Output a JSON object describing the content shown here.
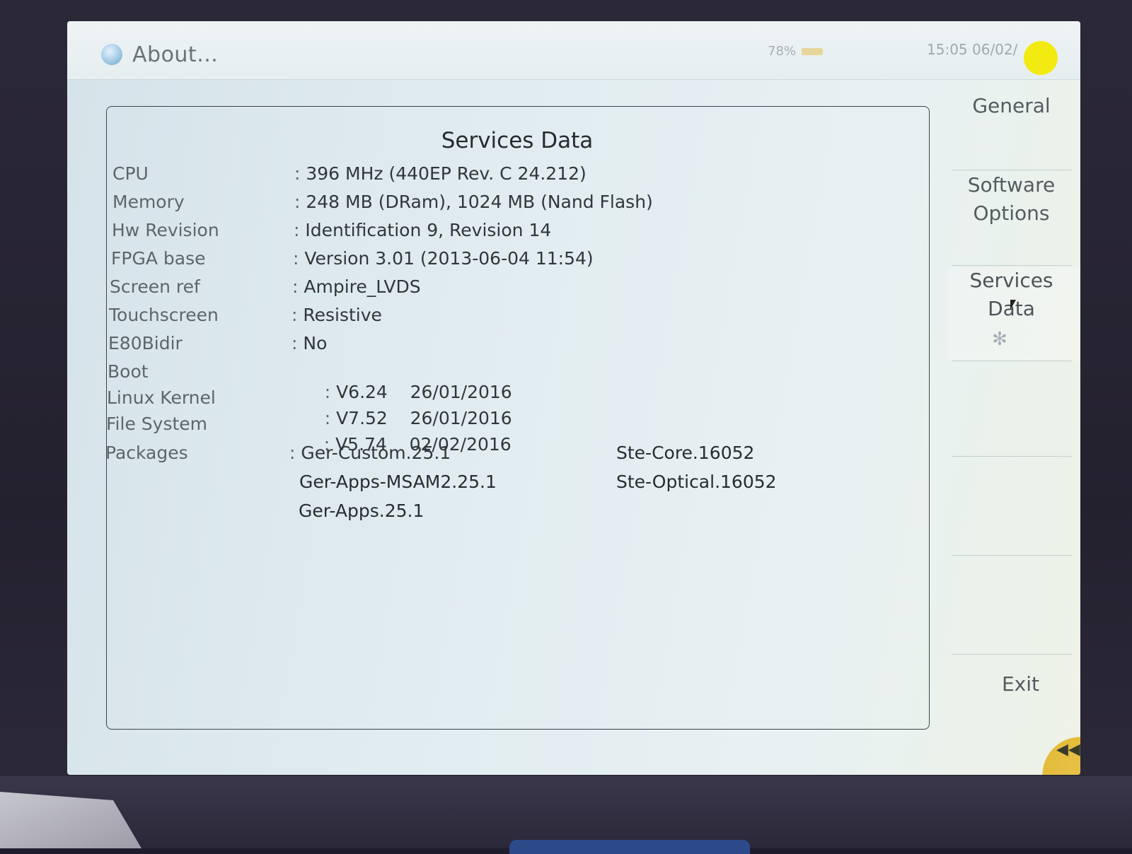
{
  "window": {
    "title": "About...",
    "battery": "78%",
    "clock": "15:05  06/02/"
  },
  "panel": {
    "title": "Services Data",
    "rows": [
      {
        "label": "CPU",
        "value": "396 MHz (440EP Rev. C 24.212)"
      },
      {
        "label": "Memory",
        "value": "248 MB (DRam), 1024 MB (Nand Flash)"
      },
      {
        "label": "Hw Revision",
        "value": "Identification 9, Revision 14"
      },
      {
        "label": "FPGA base",
        "value": "Version 3.01 (2013-06-04 11:54)"
      },
      {
        "label": "Screen ref",
        "value": "Ampire_LVDS"
      },
      {
        "label": "Touchscreen",
        "value": "Resistive"
      },
      {
        "label": "E80Bidir",
        "value": "No"
      },
      {
        "label": "Boot",
        "value": "V6.24    26/01/2016"
      },
      {
        "label": "Linux Kernel",
        "value": "V7.52    26/01/2016"
      },
      {
        "label": "File System",
        "value": "V5.74    02/02/2016"
      },
      {
        "label": "Packages",
        "value": "Ger-Custom.25.1"
      }
    ],
    "packages_col1": [
      "Ger-Apps-MSAM2.25.1",
      "Ger-Apps.25.1"
    ],
    "packages_col2": [
      "Ste-Core.16052",
      "Ste-Optical.16052"
    ]
  },
  "sidebar": {
    "general": "General",
    "software_line1": "Software",
    "software_line2": "Options",
    "services_line1": "Services",
    "services_line2": "Data",
    "exit": "Exit"
  },
  "icons": {
    "title": "globe-icon",
    "busy": "spinner-icon",
    "back": "rewind-icon"
  },
  "colors": {
    "indicator": "#f2ea11",
    "corner_tab": "#e4bc3a"
  }
}
